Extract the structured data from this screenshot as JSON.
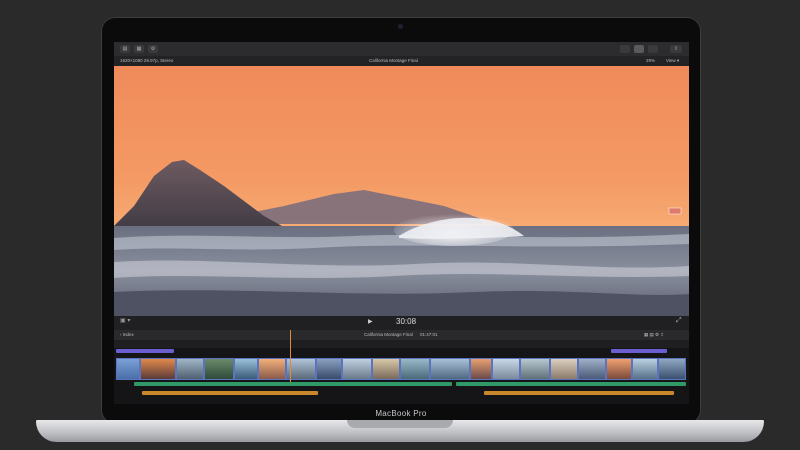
{
  "device": {
    "brand": "MacBook Pro"
  },
  "app": {
    "project_path": "1920×1080 29.97p, Stereo",
    "project_title": "California Montage Final",
    "zoom": "29%",
    "view_menu": "View ▾"
  },
  "controls": {
    "timecode": "30:08"
  },
  "timeline": {
    "index_label": "Index",
    "project_label": "California Montage Final",
    "duration": "01:47:01"
  },
  "colors": {
    "accent": "#5b7cd8",
    "audio": "#2f9a67",
    "music": "#c9862a",
    "connected": "#2a8a8a"
  },
  "icons": [
    "apple-logo-icon",
    "library-icon",
    "grid-icon",
    "settings-icon",
    "share-icon",
    "play-icon",
    "fullscreen-icon"
  ]
}
